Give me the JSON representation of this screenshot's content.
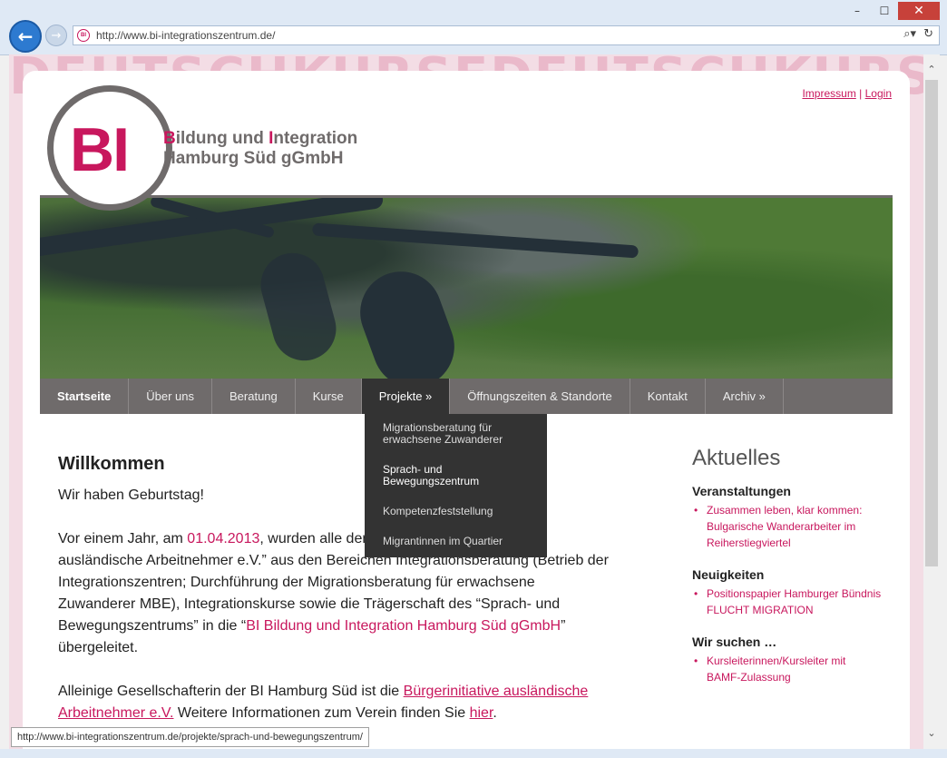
{
  "browser": {
    "url": "http://www.bi-integrationszentrum.de/",
    "status_url": "http://www.bi-integrationszentrum.de/projekte/sprach-und-bewegungszentrum/",
    "win_min": "–",
    "win_max": "☐",
    "win_close": "✕",
    "back_glyph": "←",
    "fwd_glyph": "→",
    "favicon_text": "BI",
    "search_glyph": "⌕▾",
    "refresh_glyph": "↻",
    "scroll_up_glyph": "⌃",
    "scroll_down_glyph": "⌄"
  },
  "background_text": "DEUTSCHKURSEDEUTSCHKURSE",
  "top_links": {
    "impressum": "Impressum",
    "sep": "|",
    "login": "Login"
  },
  "logo": {
    "mark": "BI",
    "line1_b": "B",
    "line1_a": "ildung und ",
    "line1_i": "I",
    "line1_c": "ntegration",
    "line2": "Hamburg Süd gGmbH"
  },
  "menu": [
    "Startseite",
    "Über uns",
    "Beratung",
    "Kurse",
    "Projekte »",
    "Öffnungszeiten & Standorte",
    "Kontakt",
    "Archiv »"
  ],
  "dropdown": [
    "Migrationsberatung für erwachsene Zuwanderer",
    "Sprach- und Bewegungszentrum",
    "Kompetenzfeststellung",
    "Migrantinnen im Quartier"
  ],
  "content": {
    "title": "Willkommen",
    "p1": "Wir haben Geburtstag!",
    "p2_a": "Vor einem Jahr, am ",
    "p2_date": "01.04.2013",
    "p2_b": ", wurden alle de",
    "p2_c": "ngebote der “Bürgerinitiative ausländische Arbeitnehmer e.V.” aus den Bereichen Integrationsberatung (Betrieb der Integrationszentren; Durchführung der Migrationsberatung für erwachsene Zuwanderer MBE), Integrationskurse sowie die Trägerschaft des “Sprach- und Bewegungszentrums” in die “",
    "p2_link": "BI Bildung und Integration Hamburg Süd gGmbH",
    "p2_d": "” übergeleitet.",
    "p3_a": "Alleinige Gesellschafterin der BI Hamburg Süd ist die ",
    "p3_link": "Bürgerinitiative ausländische Arbeitnehmer e.V.",
    "p3_b": " Weitere Informationen zum Verein finden Sie ",
    "p3_link2": "hier",
    "p3_c": "."
  },
  "sidebar": {
    "title": "Aktuelles",
    "sections": [
      {
        "heading": "Veranstaltungen",
        "items": [
          "Zusammen leben, klar kommen: Bulgarische Wanderarbeiter im Reiherstiegviertel"
        ]
      },
      {
        "heading": "Neuigkeiten",
        "items": [
          "Positionspapier Hamburger Bündnis FLUCHT MIGRATION"
        ]
      },
      {
        "heading": "Wir suchen …",
        "items": [
          "Kursleiterinnen/Kursleiter mit BAMF-Zulassung"
        ]
      }
    ]
  },
  "colors": {
    "accent": "#c8175d",
    "nav": "#6f6b6b",
    "dropdown": "#333333"
  }
}
